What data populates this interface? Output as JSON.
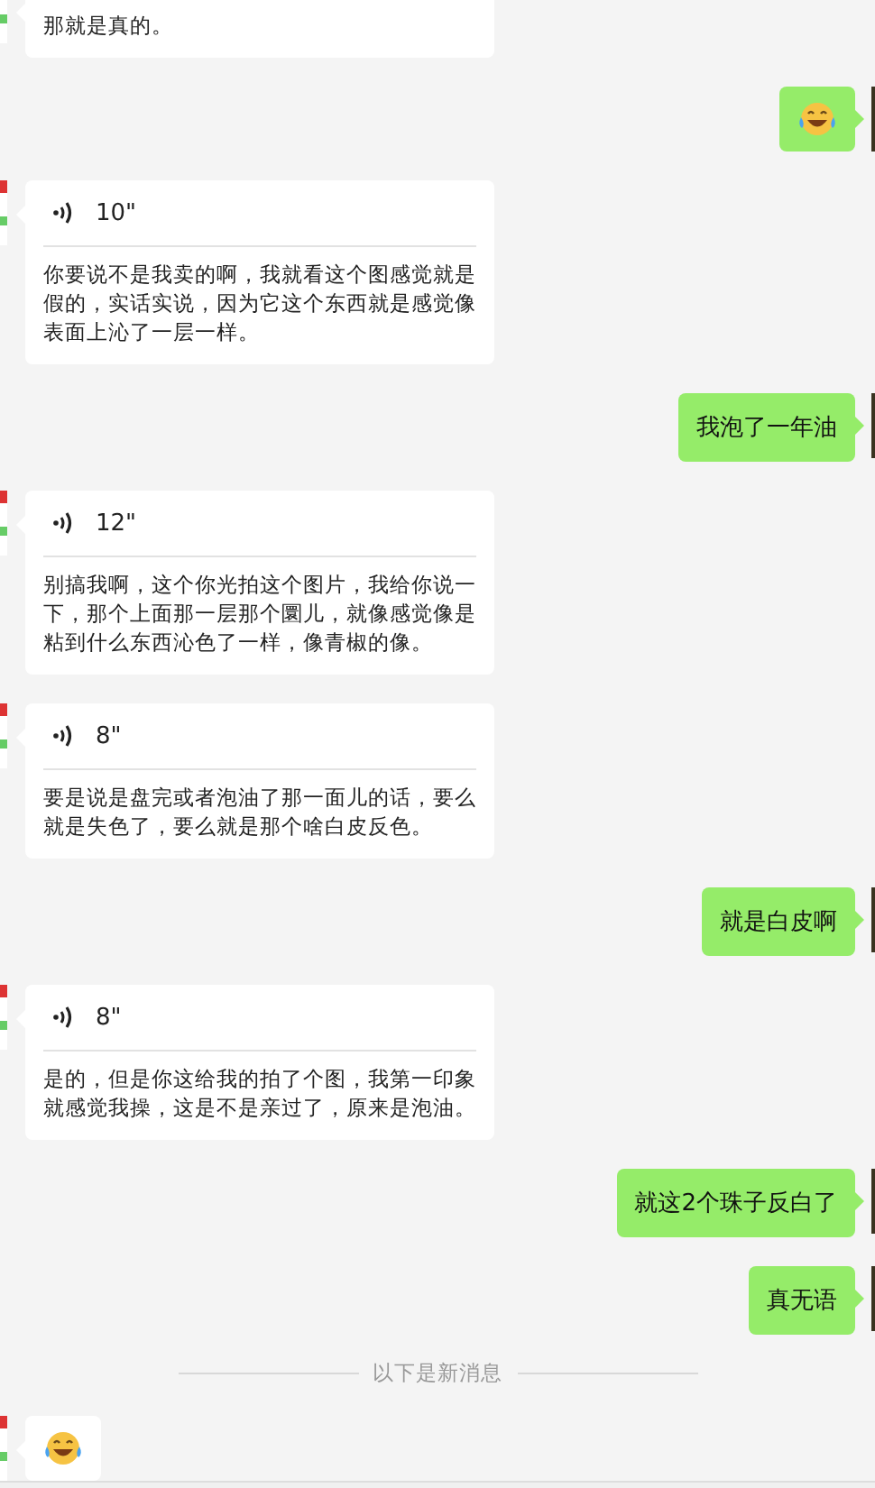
{
  "messages": [
    {
      "outgoing": false,
      "kind": "transcript_tail",
      "text": "那就是真的。"
    },
    {
      "outgoing": true,
      "kind": "emoji"
    },
    {
      "outgoing": false,
      "kind": "voice",
      "duration": "10\"",
      "text": "你要说不是我卖的啊，我就看这个图感觉就是假的，实话实说，因为它这个东西就是感觉像表面上沁了一层一样。"
    },
    {
      "outgoing": true,
      "kind": "text",
      "text": "我泡了一年油"
    },
    {
      "outgoing": false,
      "kind": "voice",
      "duration": "12\"",
      "text": "别搞我啊，这个你光拍这个图片，我给你说一下，那个上面那一层那个圜儿，就像感觉像是粘到什么东西沁色了一样，像青椒的像。"
    },
    {
      "outgoing": false,
      "kind": "voice",
      "duration": "8\"",
      "text": "要是说是盘完或者泡油了那一面儿的话，要么就是失色了，要么就是那个啥白皮反色。"
    },
    {
      "outgoing": true,
      "kind": "text",
      "text": "就是白皮啊"
    },
    {
      "outgoing": false,
      "kind": "voice",
      "duration": "8\"",
      "text": "是的，但是你这给我的拍了个图，我第一印象就感觉我操，这是不是亲过了，原来是泡油。"
    },
    {
      "outgoing": true,
      "kind": "text",
      "text": "就这2个珠子反白了"
    },
    {
      "outgoing": true,
      "kind": "text",
      "text": "真无语"
    },
    {
      "kind": "divider",
      "text": "以下是新消息"
    },
    {
      "outgoing": false,
      "kind": "emoji"
    }
  ]
}
